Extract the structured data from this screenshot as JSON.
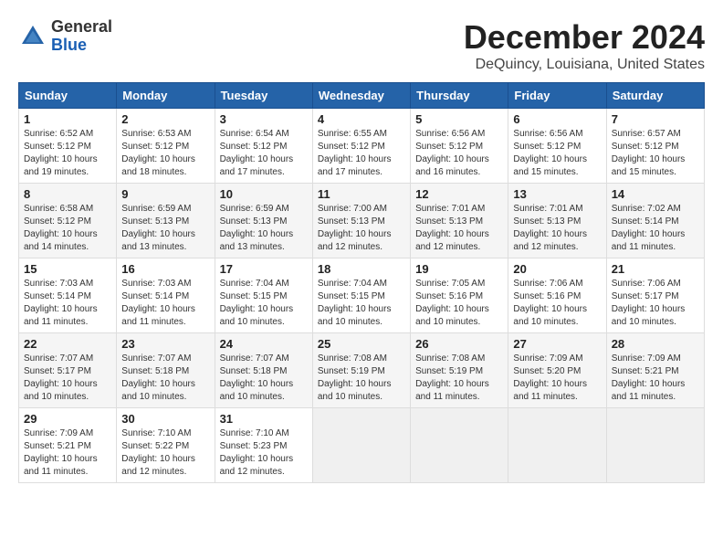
{
  "header": {
    "logo_line1": "General",
    "logo_line2": "Blue",
    "month_title": "December 2024",
    "location": "DeQuincy, Louisiana, United States"
  },
  "calendar": {
    "days_of_week": [
      "Sunday",
      "Monday",
      "Tuesday",
      "Wednesday",
      "Thursday",
      "Friday",
      "Saturday"
    ],
    "weeks": [
      [
        {
          "day": "1",
          "sunrise": "6:52 AM",
          "sunset": "5:12 PM",
          "daylight": "10 hours and 19 minutes."
        },
        {
          "day": "2",
          "sunrise": "6:53 AM",
          "sunset": "5:12 PM",
          "daylight": "10 hours and 18 minutes."
        },
        {
          "day": "3",
          "sunrise": "6:54 AM",
          "sunset": "5:12 PM",
          "daylight": "10 hours and 17 minutes."
        },
        {
          "day": "4",
          "sunrise": "6:55 AM",
          "sunset": "5:12 PM",
          "daylight": "10 hours and 17 minutes."
        },
        {
          "day": "5",
          "sunrise": "6:56 AM",
          "sunset": "5:12 PM",
          "daylight": "10 hours and 16 minutes."
        },
        {
          "day": "6",
          "sunrise": "6:56 AM",
          "sunset": "5:12 PM",
          "daylight": "10 hours and 15 minutes."
        },
        {
          "day": "7",
          "sunrise": "6:57 AM",
          "sunset": "5:12 PM",
          "daylight": "10 hours and 15 minutes."
        }
      ],
      [
        {
          "day": "8",
          "sunrise": "6:58 AM",
          "sunset": "5:12 PM",
          "daylight": "10 hours and 14 minutes."
        },
        {
          "day": "9",
          "sunrise": "6:59 AM",
          "sunset": "5:13 PM",
          "daylight": "10 hours and 13 minutes."
        },
        {
          "day": "10",
          "sunrise": "6:59 AM",
          "sunset": "5:13 PM",
          "daylight": "10 hours and 13 minutes."
        },
        {
          "day": "11",
          "sunrise": "7:00 AM",
          "sunset": "5:13 PM",
          "daylight": "10 hours and 12 minutes."
        },
        {
          "day": "12",
          "sunrise": "7:01 AM",
          "sunset": "5:13 PM",
          "daylight": "10 hours and 12 minutes."
        },
        {
          "day": "13",
          "sunrise": "7:01 AM",
          "sunset": "5:13 PM",
          "daylight": "10 hours and 12 minutes."
        },
        {
          "day": "14",
          "sunrise": "7:02 AM",
          "sunset": "5:14 PM",
          "daylight": "10 hours and 11 minutes."
        }
      ],
      [
        {
          "day": "15",
          "sunrise": "7:03 AM",
          "sunset": "5:14 PM",
          "daylight": "10 hours and 11 minutes."
        },
        {
          "day": "16",
          "sunrise": "7:03 AM",
          "sunset": "5:14 PM",
          "daylight": "10 hours and 11 minutes."
        },
        {
          "day": "17",
          "sunrise": "7:04 AM",
          "sunset": "5:15 PM",
          "daylight": "10 hours and 10 minutes."
        },
        {
          "day": "18",
          "sunrise": "7:04 AM",
          "sunset": "5:15 PM",
          "daylight": "10 hours and 10 minutes."
        },
        {
          "day": "19",
          "sunrise": "7:05 AM",
          "sunset": "5:16 PM",
          "daylight": "10 hours and 10 minutes."
        },
        {
          "day": "20",
          "sunrise": "7:06 AM",
          "sunset": "5:16 PM",
          "daylight": "10 hours and 10 minutes."
        },
        {
          "day": "21",
          "sunrise": "7:06 AM",
          "sunset": "5:17 PM",
          "daylight": "10 hours and 10 minutes."
        }
      ],
      [
        {
          "day": "22",
          "sunrise": "7:07 AM",
          "sunset": "5:17 PM",
          "daylight": "10 hours and 10 minutes."
        },
        {
          "day": "23",
          "sunrise": "7:07 AM",
          "sunset": "5:18 PM",
          "daylight": "10 hours and 10 minutes."
        },
        {
          "day": "24",
          "sunrise": "7:07 AM",
          "sunset": "5:18 PM",
          "daylight": "10 hours and 10 minutes."
        },
        {
          "day": "25",
          "sunrise": "7:08 AM",
          "sunset": "5:19 PM",
          "daylight": "10 hours and 10 minutes."
        },
        {
          "day": "26",
          "sunrise": "7:08 AM",
          "sunset": "5:19 PM",
          "daylight": "10 hours and 11 minutes."
        },
        {
          "day": "27",
          "sunrise": "7:09 AM",
          "sunset": "5:20 PM",
          "daylight": "10 hours and 11 minutes."
        },
        {
          "day": "28",
          "sunrise": "7:09 AM",
          "sunset": "5:21 PM",
          "daylight": "10 hours and 11 minutes."
        }
      ],
      [
        {
          "day": "29",
          "sunrise": "7:09 AM",
          "sunset": "5:21 PM",
          "daylight": "10 hours and 11 minutes."
        },
        {
          "day": "30",
          "sunrise": "7:10 AM",
          "sunset": "5:22 PM",
          "daylight": "10 hours and 12 minutes."
        },
        {
          "day": "31",
          "sunrise": "7:10 AM",
          "sunset": "5:23 PM",
          "daylight": "10 hours and 12 minutes."
        },
        null,
        null,
        null,
        null
      ]
    ]
  }
}
